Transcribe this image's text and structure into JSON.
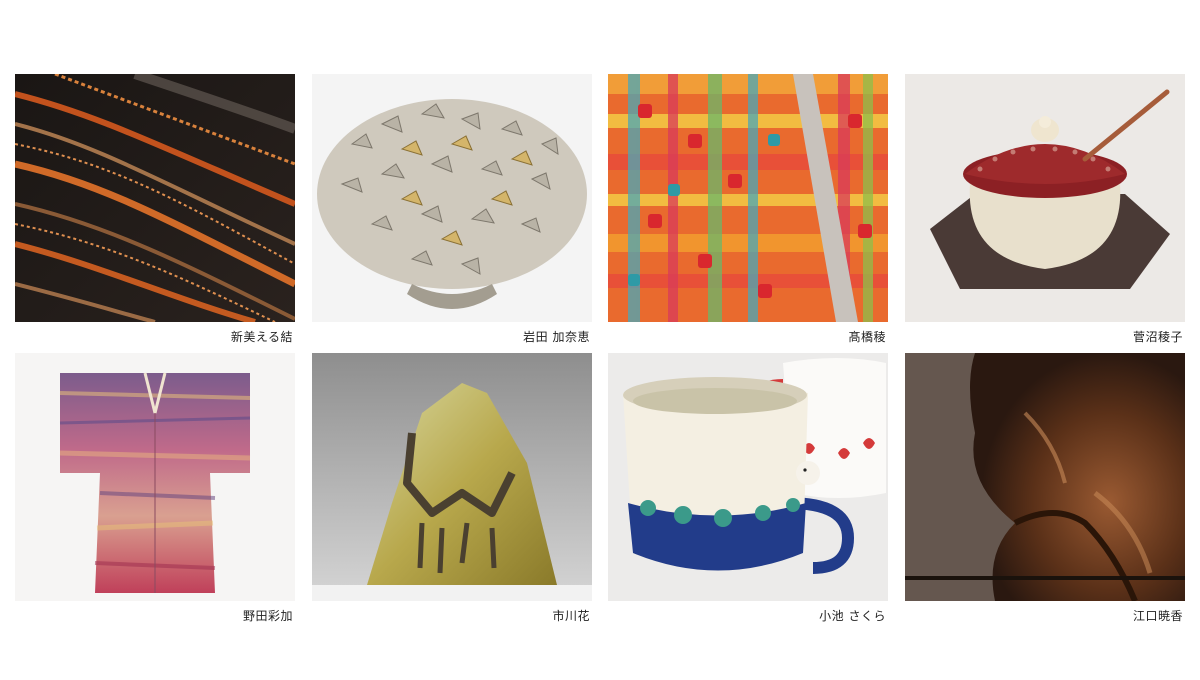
{
  "works": [
    {
      "artist": "新美える結",
      "image_icon": "dark-silk-waves-artwork"
    },
    {
      "artist": "岩田 加奈恵",
      "image_icon": "metal-butterfly-sculpture"
    },
    {
      "artist": "髙橋稜",
      "image_icon": "colorful-woven-textile"
    },
    {
      "artist": "菅沼稜子",
      "image_icon": "lidded-ceramic-jar"
    },
    {
      "artist": "野田彩加",
      "image_icon": "dyed-kimono"
    },
    {
      "artist": "市川花",
      "image_icon": "gold-glass-sculpture"
    },
    {
      "artist": "小池 さくら",
      "image_icon": "ceramic-mugs"
    },
    {
      "artist": "江口暁香",
      "image_icon": "wooden-figure-sculpture"
    }
  ]
}
